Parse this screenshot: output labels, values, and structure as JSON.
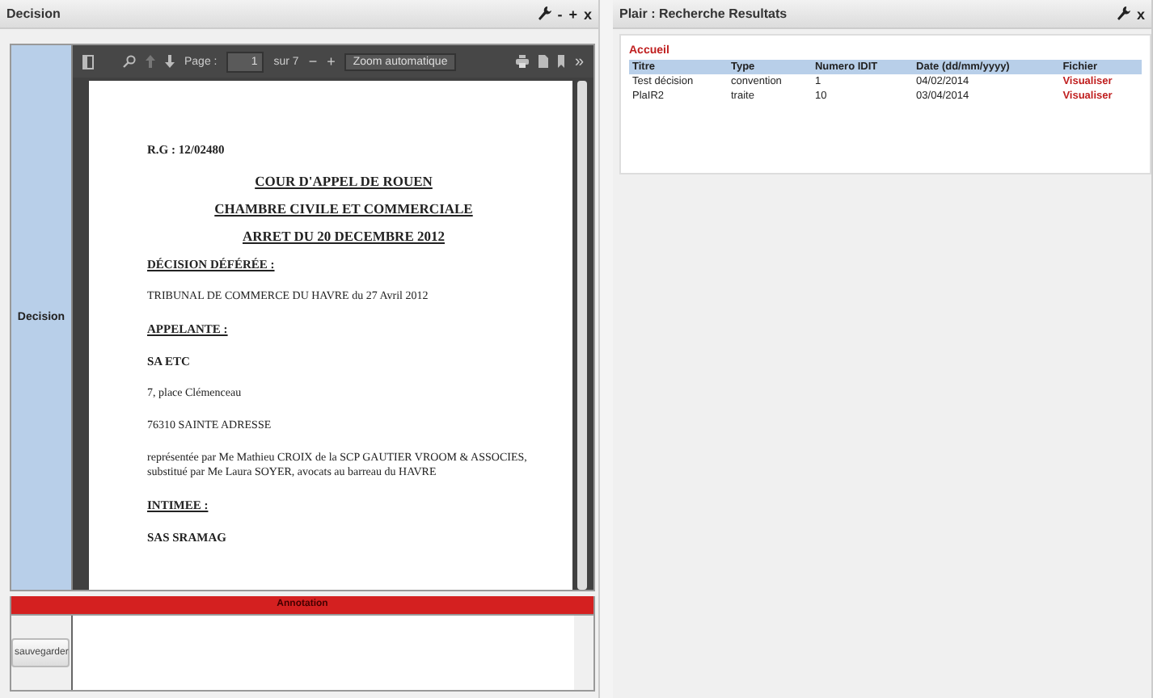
{
  "left_panel": {
    "title": "Decision",
    "controls": [
      "-",
      "+",
      "x"
    ],
    "side_label": "Decision",
    "viewer": {
      "page_label": "Page :",
      "page_value": "1",
      "page_total": "sur 7",
      "zoom_out": "−",
      "zoom_in": "+",
      "zoom_select": "Zoom automatique",
      "more": "»"
    },
    "document": [
      {
        "kind": "bold",
        "text": "R.G : 12/02480"
      },
      {
        "kind": "title",
        "text": "COUR D'APPEL DE ROUEN"
      },
      {
        "kind": "title",
        "text": "CHAMBRE CIVILE ET COMMERCIALE"
      },
      {
        "kind": "title",
        "text": "ARRET DU 20 DECEMBRE 2012"
      },
      {
        "kind": "heading",
        "text": "DÉCISION DÉFÉRÉE :"
      },
      {
        "kind": "plain",
        "text": "TRIBUNAL DE COMMERCE DU HAVRE du 27 Avril 2012"
      },
      {
        "kind": "heading",
        "text": "APPELANTE :"
      },
      {
        "kind": "bold",
        "text": "SA ETC"
      },
      {
        "kind": "plain",
        "text": "7, place Clémenceau"
      },
      {
        "kind": "plain",
        "text": "76310 SAINTE ADRESSE"
      },
      {
        "kind": "plain",
        "text": "représentée par Me Mathieu CROIX de la SCP GAUTIER VROOM & ASSOCIES, substitué par Me Laura SOYER, avocats au barreau du HAVRE"
      },
      {
        "kind": "heading",
        "text": "INTIMEE :"
      },
      {
        "kind": "bold",
        "text": "SAS SRAMAG"
      }
    ],
    "annotation_title": "Annotation",
    "save_button": "sauvegarder"
  },
  "right_panel": {
    "title": "Plair : Recherche Resultats",
    "controls": [
      "x"
    ],
    "breadcrumb": "Accueil",
    "table": {
      "columns": [
        "Titre",
        "Type",
        "Numero IDIT",
        "Date (dd/mm/yyyy)",
        "Fichier"
      ],
      "rows": [
        [
          "Test décision",
          "convention",
          "1",
          "04/02/2014",
          "Visualiser"
        ],
        [
          "PlaIR2",
          "traite",
          "10",
          "03/04/2014",
          "Visualiser"
        ]
      ]
    }
  }
}
